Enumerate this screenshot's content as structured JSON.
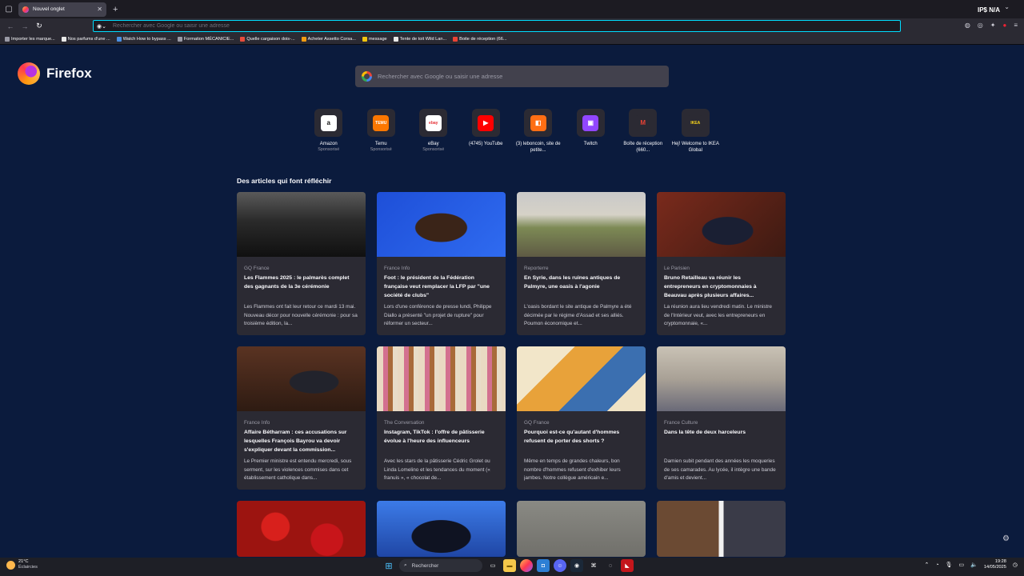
{
  "browser": {
    "tab": {
      "title": "Nouvel onglet"
    },
    "url_placeholder": "Rechercher avec Google ou saisir une adresse",
    "badges": "IP$ N/A",
    "bookmarks": [
      {
        "label": "Importer les marque...",
        "color": "#9a9aa6"
      },
      {
        "label": "Nos parfums d'une ...",
        "color": "#e8e8e8"
      },
      {
        "label": "Watch How to bypass ...",
        "color": "#4a90e2"
      },
      {
        "label": "Formation MÉCANICIE...",
        "color": "#9a9aa6"
      },
      {
        "label": "Quelle cargaison dois-...",
        "color": "#e74c3c"
      },
      {
        "label": "Acheter Assetto Corsa...",
        "color": "#f39c12"
      },
      {
        "label": "message",
        "color": "#f1c40f"
      },
      {
        "label": "Tente de toit Wild Lan...",
        "color": "#e8e8e8"
      },
      {
        "label": "Boite de réception (66...",
        "color": "#ea4335"
      }
    ]
  },
  "ntp": {
    "brand": "Firefox",
    "search_placeholder": "Rechercher avec Google ou saisir une adresse",
    "shortcuts": [
      {
        "title": "Amazon",
        "sponsored": "Sponsorisé",
        "icon": "amazon-icon",
        "bg": "#ffffff",
        "fg": "#111111",
        "glyph": "a"
      },
      {
        "title": "Temu",
        "sponsored": "Sponsorisé",
        "icon": "temu-icon",
        "bg": "#fb7701",
        "fg": "#ffffff",
        "glyph": "TEMU"
      },
      {
        "title": "eBay",
        "sponsored": "Sponsorisé",
        "icon": "ebay-icon",
        "bg": "#ffffff",
        "fg": "#e53238",
        "glyph": "ebay"
      },
      {
        "title": "(4745) YouTube",
        "sponsored": "",
        "icon": "youtube-icon",
        "bg": "#ff0000",
        "fg": "#ffffff",
        "glyph": "▶"
      },
      {
        "title": "(3) leboncoin, site de petite...",
        "sponsored": "",
        "icon": "leboncoin-icon",
        "bg": "#ff6e14",
        "fg": "#ffffff",
        "glyph": "◧"
      },
      {
        "title": "Twitch",
        "sponsored": "",
        "icon": "twitch-icon",
        "bg": "#9146ff",
        "fg": "#ffffff",
        "glyph": "▣"
      },
      {
        "title": "Boîte de réception (660...",
        "sponsored": "",
        "icon": "gmail-icon",
        "bg": "#2b2a33",
        "fg": "#ea4335",
        "glyph": "M"
      },
      {
        "title": "Hej! Welcome to IKEA Global",
        "sponsored": "",
        "icon": "ikea-icon",
        "bg": "#2b2a33",
        "fg": "#ffda1a",
        "glyph": "IKEA"
      }
    ],
    "section_title": "Des articles qui font réfléchir",
    "articles": [
      {
        "source": "GQ France",
        "title": "Les Flammes 2025 : le palmarès complet des gagnants de la 3e cérémonie",
        "desc": "Les Flammes ont fait leur retour ce mardi 13 mai. Nouveau décor pour nouvelle cérémonie : pour sa troisième édition, la...",
        "img": "linear-gradient(180deg,#5a5a5a 0%,#2a2a2a 45%,#101010 100%)"
      },
      {
        "source": "France Info",
        "title": "Foot : le président de la Fédération française veut remplacer la LFP par \"une société de clubs\"",
        "desc": "Lors d'une conférence de presse lundi, Philippe Diallo a présenté \"un projet de rupture\" pour réformer un secteur...",
        "img": "radial-gradient(ellipse at 50% 55%,#3a2418 0 28%,transparent 29%),linear-gradient(135deg,#1e4fd8,#2f6bf0)"
      },
      {
        "source": "Reporterre",
        "title": "En Syrie, dans les ruines antiques de Palmyre, une oasis à l'agonie",
        "desc": "L'oasis bordant le site antique de Palmyre a été décimée par le régime d'Assad et ses alliés. Poumon économique et...",
        "img": "linear-gradient(180deg,#c9c9c9 0%,#d6d2c8 35%,#7d8a55 55%,#5e5a44 100%)"
      },
      {
        "source": "Le Parisien",
        "title": "Bruno Retailleau va réunir les entrepreneurs en cryptomonnaies à Beauvau après plusieurs affaires...",
        "desc": "La réunion aura lieu vendredi matin. Le ministre de l'Intérieur veut, avec les entrepreneurs en cryptomonnaie, «...",
        "img": "radial-gradient(ellipse at 55% 60%,#1a1f33 0 25%,transparent 26%),linear-gradient(135deg,#7a2a1c,#3d1a12)"
      },
      {
        "source": "France Info",
        "title": "Affaire Bétharram : ces accusations sur lesquelles François Bayrou va devoir s'expliquer devant la commission...",
        "desc": "Le Premier ministre est entendu mercredi, sous serment, sur les violences commises dans cet établissement catholique dans...",
        "img": "radial-gradient(ellipse at 60% 55%,#22232c 0 22%,transparent 23%),linear-gradient(180deg,#5a3322,#2e1b12)"
      },
      {
        "source": "The Conversation",
        "title": "Instagram, TikTok : l'offre de pâtisserie évolue à l'heure des influenceurs",
        "desc": "Avec les stars de la pâtisserie Cédric Grolet ou Linda Lomelino et les tendances du moment (« franuis », « chocolat de...",
        "img": "repeating-linear-gradient(90deg,#e9d9c2 0 8px,#d3708f 8px 14px,#a86a3a 14px 20px,#e8dcc8 20px 26px),linear-gradient(#8fbf3a,#8fbf3a)"
      },
      {
        "source": "GQ France",
        "title": "Pourquoi est-ce qu'autant d'hommes refusent de porter des shorts ?",
        "desc": "Même en temps de grandes chaleurs, bon nombre d'hommes refusent d'exhiber leurs jambes. Notre collègue américain e...",
        "img": "linear-gradient(135deg,#f2e6c9 0 30%,#e8a23a 30% 55%,#3b6fb0 55% 80%,#f0e3c5 80%)"
      },
      {
        "source": "France Culture",
        "title": "Dans la tête de deux harceleurs",
        "desc": "Damien subit pendant des années les moqueries de ses camarades. Au lycée, il intègre une bande d'amis et devient...",
        "img": "linear-gradient(180deg,#c9c2b5 0%,#a9a196 50%,#6a6a78 100%)"
      },
      {
        "source": "",
        "title": "",
        "desc": "",
        "img": "radial-gradient(circle at 30% 40%,#d8201c 0 14%,transparent 15%),radial-gradient(circle at 70% 60%,#c8151a 0 16%,transparent 17%),linear-gradient(#9c1410,#9c1410)"
      },
      {
        "source": "",
        "title": "",
        "desc": "",
        "img": "radial-gradient(ellipse at 50% 55%,#0f1322 0 32%,transparent 33%),linear-gradient(180deg,#3c7be8,#1b3e9a)"
      },
      {
        "source": "",
        "title": "",
        "desc": "",
        "img": "linear-gradient(180deg,#8a8a84,#6c6b66)"
      },
      {
        "source": "",
        "title": "",
        "desc": "",
        "img": "linear-gradient(90deg,#6b4a33 0 48%,#f1f1f1 48% 52%,#3a3b48 52%)"
      }
    ]
  },
  "taskbar": {
    "weather_temp": "21°C",
    "weather_desc": "Éclaircies",
    "search_label": "Rechercher",
    "time": "19:28",
    "date": "14/05/2025"
  }
}
